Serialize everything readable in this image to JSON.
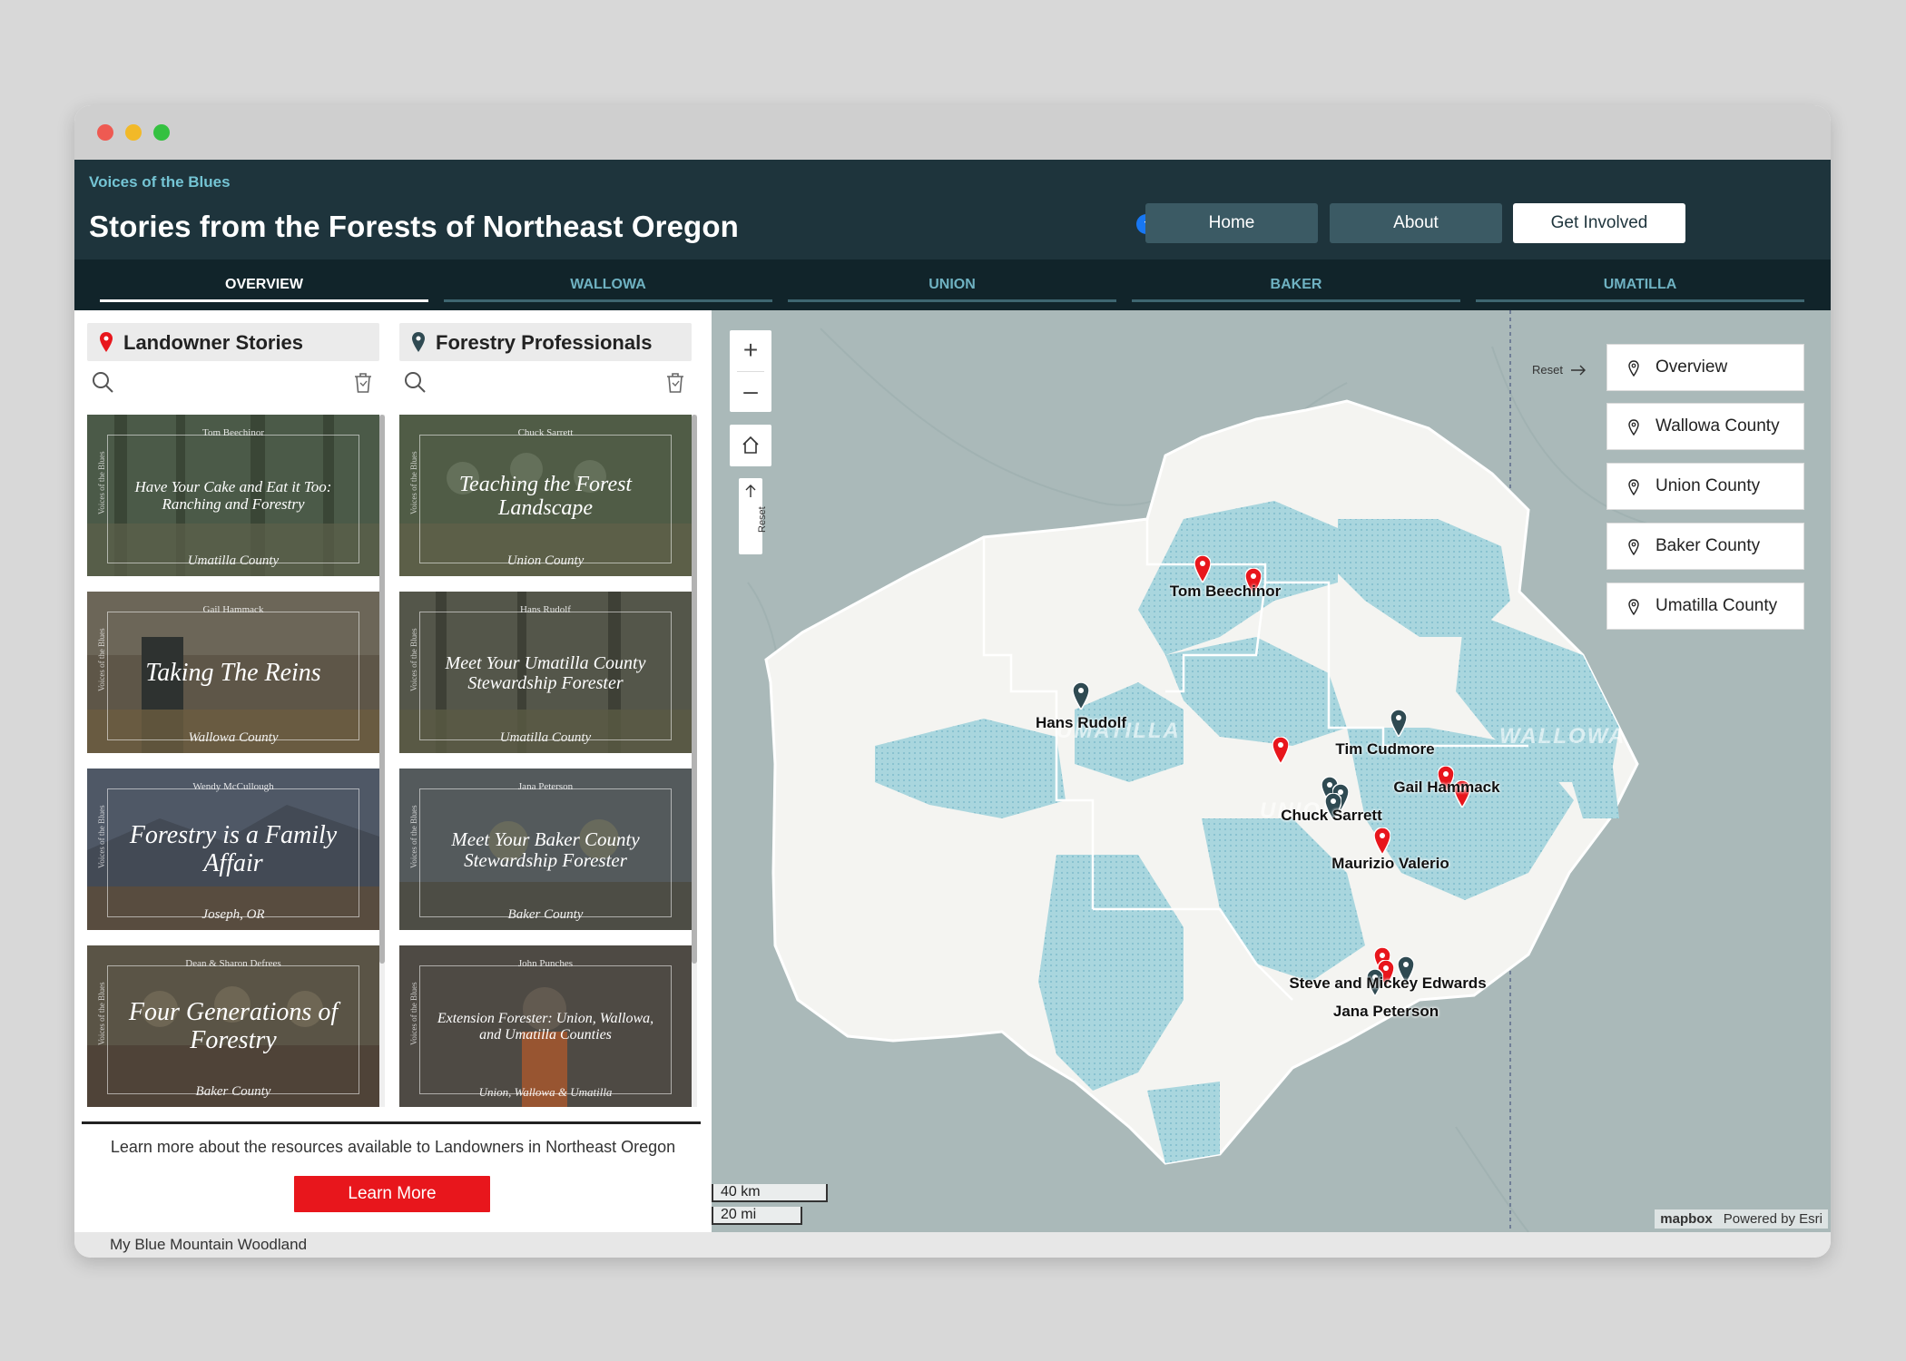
{
  "app": {
    "kicker": "Voices of the Blues",
    "title": "Stories from the Forests of Northeast Oregon",
    "social": [
      "facebook",
      "twitter",
      "link"
    ],
    "nav": {
      "home": "Home",
      "about": "About",
      "get_involved": "Get Involved"
    }
  },
  "tabs": [
    {
      "label": "OVERVIEW",
      "active": true
    },
    {
      "label": "WALLOWA",
      "active": false
    },
    {
      "label": "UNION",
      "active": false
    },
    {
      "label": "BAKER",
      "active": false
    },
    {
      "label": "UMATILLA",
      "active": false
    }
  ],
  "landowner": {
    "title": "Landowner Stories",
    "pin_color": "#e8161c",
    "cards": [
      {
        "author": "Tom Beechinor",
        "title": "Have Your Cake and Eat it Too: Ranching and Forestry",
        "place": "Umatilla County",
        "side": "Voices of the Blues",
        "bg": "#4b5a48"
      },
      {
        "author": "Gail Hammack",
        "title": "Taking The Reins",
        "place": "Wallowa County",
        "side": "Voices of the Blues",
        "bg": "#5e5648"
      },
      {
        "author": "Wendy McCullough",
        "title": "Forestry is a Family Affair",
        "place": "Joseph, OR",
        "side": "Voices of the Blues",
        "bg": "#4f5866"
      },
      {
        "author": "Dean & Sharon Defrees",
        "title": "Four Generations of Forestry",
        "place": "Baker County",
        "side": "Voices of the Blues",
        "bg": "#5a5446"
      }
    ]
  },
  "professionals": {
    "title": "Forestry Professionals",
    "pin_color": "#2f4a52",
    "cards": [
      {
        "author": "Chuck Sarrett",
        "title": "Teaching the Forest Landscape",
        "place": "Union County",
        "side": "Voices of the Blues",
        "bg": "#505c46"
      },
      {
        "author": "Hans Rudolf",
        "title": "Meet Your Umatilla County Stewardship Forester",
        "place": "Umatilla County",
        "side": "Voices of the Blues",
        "bg": "#54564a"
      },
      {
        "author": "Jana Peterson",
        "title": "Meet Your Baker County Stewardship Forester",
        "place": "Baker County",
        "side": "Voices of the Blues",
        "bg": "#545a5c"
      },
      {
        "author": "John Punches",
        "title": "Extension Forester: Union, Wallowa, and Umatilla Counties",
        "place": "Union, Wallowa & Umatilla",
        "side": "Voices of the Blues",
        "bg": "#4e4a44"
      }
    ]
  },
  "resources": {
    "text": "Learn more about the resources available to Landowners in Northeast Oregon",
    "button": "Learn More"
  },
  "status_bar": "My Blue Mountain Woodland",
  "map": {
    "reset_vertical": "Reset",
    "reset_horizontal": "Reset",
    "location_buttons": [
      "Overview",
      "Wallowa County",
      "Union County",
      "Baker County",
      "Umatilla County"
    ],
    "county_labels": [
      "UMATILLA",
      "WALLOWA",
      "UNION"
    ],
    "markers": [
      {
        "name": "Tom Beechinor"
      },
      {
        "name": "Hans Rudolf"
      },
      {
        "name": "Tim Cudmore"
      },
      {
        "name": "Gail Hammack"
      },
      {
        "name": "Chuck Sarrett"
      },
      {
        "name": "Maurizio Valerio"
      },
      {
        "name": "Steve and Mickey Edwards"
      },
      {
        "name": "Jana Peterson"
      }
    ],
    "scale_km": "40 km",
    "scale_mi": "20 mi",
    "attribution": {
      "provider": "mapbox",
      "powered_by": "Powered by Esri"
    }
  }
}
